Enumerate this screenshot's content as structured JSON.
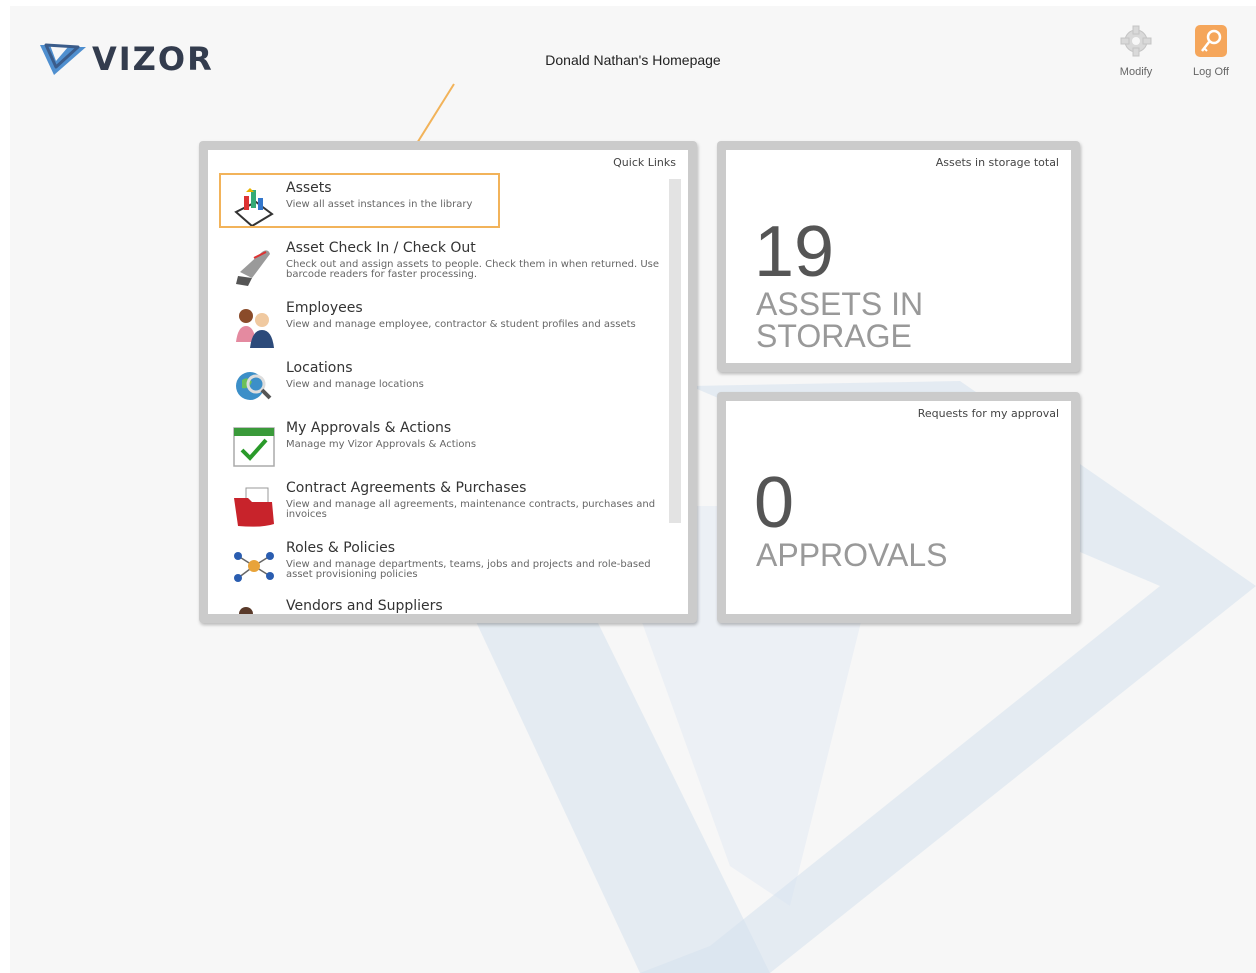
{
  "header": {
    "logo_text": "VIZOR",
    "page_title": "Donald Nathan's Homepage",
    "actions": [
      {
        "label": "Modify",
        "icon": "gear-icon"
      },
      {
        "label": "Log Off",
        "icon": "key-icon"
      }
    ]
  },
  "quick_links": {
    "title": "Quick Links",
    "items": [
      {
        "title": "Assets",
        "description": "View all asset instances in the library",
        "icon": "assets-icon"
      },
      {
        "title": "Asset Check In / Check Out",
        "description": "Check out and assign assets to people. Check them in when returned. Use barcode readers for faster processing.",
        "icon": "barcode-scanner-icon"
      },
      {
        "title": "Employees",
        "description": "View and manage employee, contractor & student profiles and assets",
        "icon": "employees-icon"
      },
      {
        "title": "Locations",
        "description": "View and manage locations",
        "icon": "globe-search-icon"
      },
      {
        "title": "My Approvals & Actions",
        "description": "Manage my Vizor Approvals & Actions",
        "icon": "calendar-check-icon"
      },
      {
        "title": "Contract Agreements & Purchases",
        "description": "View and manage all agreements, maintenance contracts, purchases and invoices",
        "icon": "folder-documents-icon"
      },
      {
        "title": "Roles & Policies",
        "description": "View and manage departments, teams, jobs and projects and role-based asset provisioning policies",
        "icon": "network-icon"
      },
      {
        "title": "Vendors and Suppliers",
        "description": "",
        "icon": "vendors-icon"
      }
    ]
  },
  "widgets": {
    "storage": {
      "title": "Assets in storage total",
      "value": "19",
      "label": "ASSETS IN STORAGE"
    },
    "approvals": {
      "title": "Requests for my approval",
      "value": "0",
      "label": "APPROVALS"
    }
  },
  "colors": {
    "accent": "#f2b35a",
    "logo": "#333c4e",
    "panel_border": "#cbcbcb"
  }
}
